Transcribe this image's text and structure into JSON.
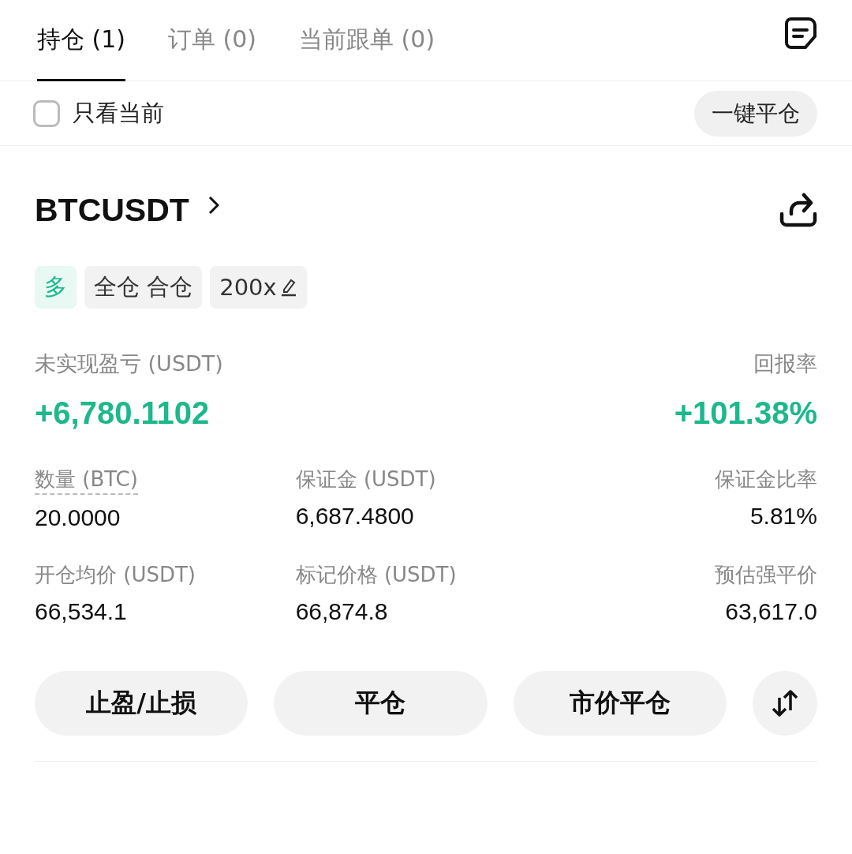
{
  "tabs": [
    {
      "label": "持仓 (1)",
      "selected": true
    },
    {
      "label": "订单 (0)",
      "selected": false
    },
    {
      "label": "当前跟单 (0)",
      "selected": false
    }
  ],
  "filter": {
    "label": "只看当前",
    "checked": false
  },
  "close_all_button": "一键平仓",
  "position": {
    "symbol": "BTCUSDT",
    "tags": [
      {
        "kind": "side",
        "text": "多"
      },
      {
        "kind": "mode",
        "text": "全仓 合仓"
      },
      {
        "kind": "leverage",
        "text": "200x"
      }
    ],
    "pnl_label": "未实现盈亏 (USDT)",
    "pnl_value": "+6,780.1102",
    "roe_label": "回报率",
    "roe_value": "+101.38%",
    "metrics": [
      {
        "label": "数量 (BTC)",
        "value": "20.0000",
        "underlined": true
      },
      {
        "label": "保证金 (USDT)",
        "value": "6,687.4800",
        "underlined": false
      },
      {
        "label": "保证金比率",
        "value": "5.81%",
        "underlined": false
      },
      {
        "label": "开仓均价 (USDT)",
        "value": "66,534.1",
        "underlined": false
      },
      {
        "label": "标记价格 (USDT)",
        "value": "66,874.8",
        "underlined": false
      },
      {
        "label": "预估强平价",
        "value": "63,617.0",
        "underlined": false
      }
    ],
    "actions": [
      "止盈/止损",
      "平仓",
      "市价平仓"
    ]
  }
}
